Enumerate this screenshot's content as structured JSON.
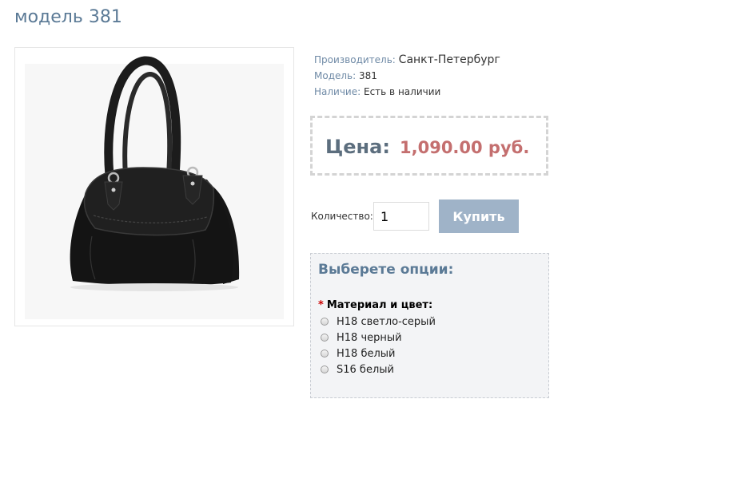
{
  "product": {
    "title": "модель 381",
    "image_icon": "black-handbag-photo"
  },
  "info": {
    "manufacturer_label": "Производитель:",
    "manufacturer_value": "Санкт-Петербург",
    "model_label": "Модель:",
    "model_value": "381",
    "availability_label": "Наличие:",
    "availability_value": "Есть в наличии"
  },
  "price": {
    "label": "Цена:",
    "value": "1,090.00 руб."
  },
  "purchase": {
    "quantity_label": "Количество:",
    "quantity_value": "1",
    "buy_label": "Купить"
  },
  "options": {
    "title": "Выберете опции:",
    "group_required_mark": "*",
    "group_label": "Материал и цвет:",
    "items": [
      {
        "label": "Н18 светло-серый"
      },
      {
        "label": "Н18 черный"
      },
      {
        "label": "Н18 белый"
      },
      {
        "label": "S16 белый"
      }
    ]
  },
  "colors": {
    "title": "#5b7a96",
    "price": "#c46f6f",
    "button": "#9fb3c8"
  }
}
